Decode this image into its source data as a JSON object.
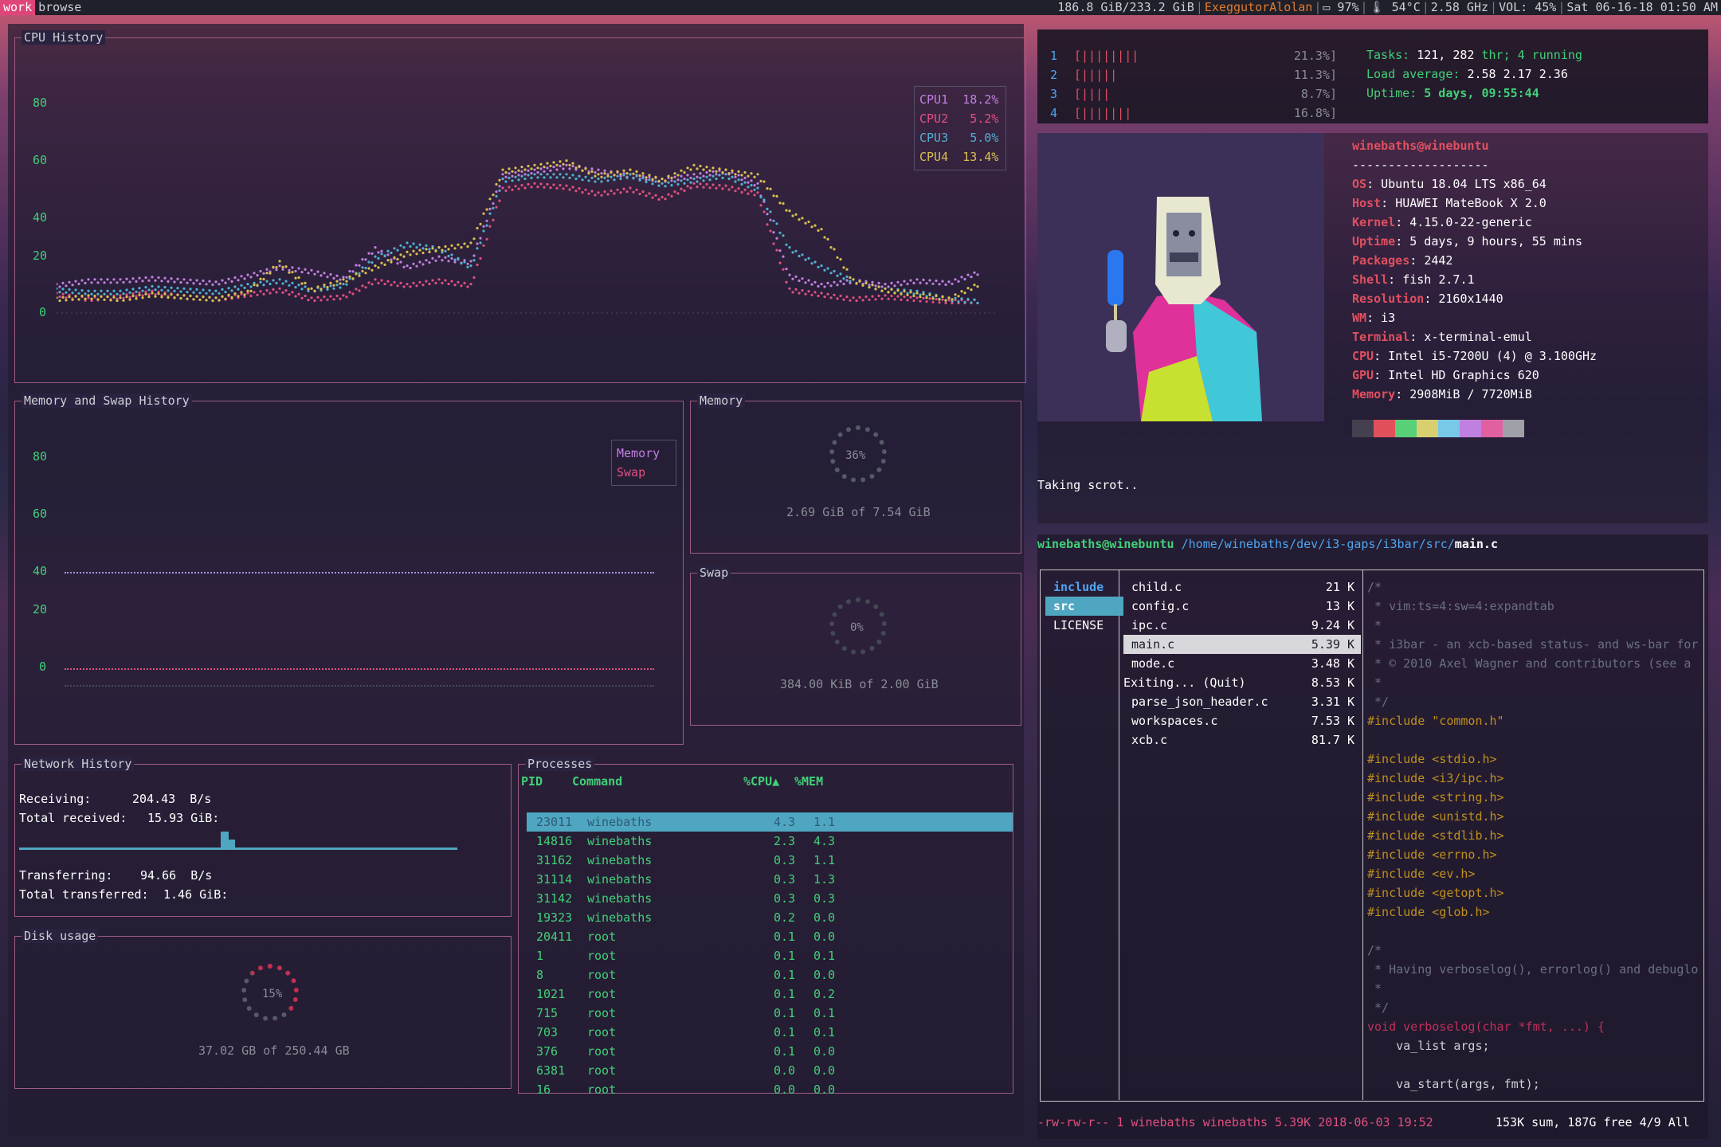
{
  "topbar": {
    "workspaces": [
      "work",
      "browse"
    ],
    "disk": "186.8 GiB/233.2 GiB",
    "wifi": "ExeggutorAlolan",
    "battery": "97%",
    "temp": "54°C",
    "freq": "2.58 GHz",
    "volume": "VOL: 45%",
    "datetime": "Sat 06-16-18 01:50 AM"
  },
  "cpu_history": {
    "title": "CPU History",
    "yticks": [
      "80",
      "60",
      "40",
      "20",
      "0"
    ],
    "legend": [
      {
        "label": "CPU1",
        "value": "18.2%",
        "color": "#c080e0"
      },
      {
        "label": "CPU2",
        "value": "5.2%",
        "color": "#e05080"
      },
      {
        "label": "CPU3",
        "value": "5.0%",
        "color": "#50b0d0"
      },
      {
        "label": "CPU4",
        "value": "13.4%",
        "color": "#d8c050"
      }
    ]
  },
  "chart_data": {
    "type": "line",
    "title": "CPU History",
    "ylim": [
      0,
      100
    ],
    "series": [
      {
        "name": "CPU1",
        "values": [
          12,
          14,
          14,
          15,
          14,
          13,
          16,
          20,
          18,
          15,
          28,
          20,
          24,
          22,
          60,
          62,
          64,
          62,
          60,
          58,
          60,
          62,
          56,
          16,
          12,
          14,
          12,
          14,
          13,
          18
        ]
      },
      {
        "name": "CPU2",
        "values": [
          8,
          6,
          7,
          9,
          7,
          6,
          8,
          10,
          6,
          7,
          14,
          12,
          14,
          12,
          54,
          56,
          55,
          52,
          54,
          50,
          56,
          55,
          52,
          10,
          8,
          6,
          7,
          6,
          5,
          5
        ]
      },
      {
        "name": "CPU3",
        "values": [
          10,
          9,
          9,
          11,
          10,
          9,
          12,
          14,
          10,
          12,
          24,
          30,
          28,
          20,
          58,
          60,
          60,
          58,
          60,
          56,
          58,
          60,
          54,
          28,
          20,
          14,
          10,
          9,
          6,
          5
        ]
      },
      {
        "name": "CPU4",
        "values": [
          6,
          7,
          6,
          8,
          7,
          6,
          9,
          22,
          10,
          14,
          20,
          26,
          28,
          30,
          62,
          64,
          66,
          60,
          62,
          58,
          64,
          62,
          60,
          44,
          36,
          14,
          10,
          8,
          6,
          13
        ]
      }
    ]
  },
  "memswap": {
    "title": "Memory and Swap History",
    "yticks": [
      "80",
      "60",
      "40",
      "20",
      "0"
    ],
    "legend": [
      {
        "label": "Memory",
        "color": "#c080e0"
      },
      {
        "label": "Swap",
        "color": "#e05080"
      }
    ]
  },
  "memory": {
    "title": "Memory",
    "percent": "36%",
    "text": "2.69 GiB of 7.54 GiB"
  },
  "swap": {
    "title": "Swap",
    "percent": "0%",
    "text": "384.00 KiB of 2.00 GiB"
  },
  "network": {
    "title": "Network History",
    "receiving_label": "Receiving:",
    "receiving_value": "204.43  B/s",
    "total_received_label": "Total received:",
    "total_received_value": "15.93 GiB:",
    "transferring_label": "Transferring:",
    "transferring_value": "94.66  B/s",
    "total_transferred_label": "Total transferred:",
    "total_transferred_value": "1.46 GiB:"
  },
  "disk": {
    "title": "Disk usage",
    "percent": "15%",
    "text": "37.02 GB of 250.44 GB"
  },
  "processes": {
    "title": "Processes",
    "headers": [
      "PID",
      "Command",
      "%CPU▲",
      "%MEM"
    ],
    "rows": [
      {
        "pid": "23011",
        "cmd": "winebaths",
        "cpu": "4.3",
        "mem": "1.1"
      },
      {
        "pid": "14816",
        "cmd": "winebaths",
        "cpu": "2.3",
        "mem": "4.3"
      },
      {
        "pid": "31162",
        "cmd": "winebaths",
        "cpu": "0.3",
        "mem": "1.1"
      },
      {
        "pid": "31114",
        "cmd": "winebaths",
        "cpu": "0.3",
        "mem": "1.3"
      },
      {
        "pid": "31142",
        "cmd": "winebaths",
        "cpu": "0.3",
        "mem": "0.3"
      },
      {
        "pid": "19323",
        "cmd": "winebaths",
        "cpu": "0.2",
        "mem": "0.0"
      },
      {
        "pid": "20411",
        "cmd": "root",
        "cpu": "0.1",
        "mem": "0.0"
      },
      {
        "pid": "1",
        "cmd": "root",
        "cpu": "0.1",
        "mem": "0.1"
      },
      {
        "pid": "8",
        "cmd": "root",
        "cpu": "0.1",
        "mem": "0.0"
      },
      {
        "pid": "1021",
        "cmd": "root",
        "cpu": "0.1",
        "mem": "0.2"
      },
      {
        "pid": "715",
        "cmd": "root",
        "cpu": "0.1",
        "mem": "0.1"
      },
      {
        "pid": "703",
        "cmd": "root",
        "cpu": "0.1",
        "mem": "0.1"
      },
      {
        "pid": "376",
        "cmd": "root",
        "cpu": "0.1",
        "mem": "0.0"
      },
      {
        "pid": "6381",
        "cmd": "root",
        "cpu": "0.0",
        "mem": "0.0"
      },
      {
        "pid": "16",
        "cmd": "root",
        "cpu": "0.0",
        "mem": "0.0"
      }
    ]
  },
  "htop": {
    "cpus": [
      {
        "num": "1",
        "bar": "[||||||||",
        "pct": "21.3%]"
      },
      {
        "num": "2",
        "bar": "[|||||",
        "pct": "11.3%]"
      },
      {
        "num": "3",
        "bar": "[||||",
        "pct": "8.7%]"
      },
      {
        "num": "4",
        "bar": "[|||||||",
        "pct": "16.8%]"
      }
    ],
    "tasks_label": "Tasks:",
    "tasks_value": "121,",
    "threads_value": "282",
    "threads_label": "thr;",
    "running_value": "4",
    "running_label": "running",
    "load_label": "Load average:",
    "load_values": "2.58 2.17 2.36",
    "uptime_label": "Uptime:",
    "uptime_value": "5 days, 09:55:44"
  },
  "neofetch": {
    "userhost": "winebaths@winebuntu",
    "separator": "-------------------",
    "info": [
      {
        "key": "OS",
        "value": "Ubuntu 18.04 LTS x86_64"
      },
      {
        "key": "Host",
        "value": "HUAWEI MateBook X 2.0"
      },
      {
        "key": "Kernel",
        "value": "4.15.0-22-generic"
      },
      {
        "key": "Uptime",
        "value": "5 days, 9 hours, 55 mins"
      },
      {
        "key": "Packages",
        "value": "2442"
      },
      {
        "key": "Shell",
        "value": "fish 2.7.1"
      },
      {
        "key": "Resolution",
        "value": "2160x1440"
      },
      {
        "key": "WM",
        "value": "i3"
      },
      {
        "key": "Terminal",
        "value": "x-terminal-emul"
      },
      {
        "key": "CPU",
        "value": "Intel i5-7200U (4) @ 3.100GHz"
      },
      {
        "key": "GPU",
        "value": "Intel HD Graphics 620"
      },
      {
        "key": "Memory",
        "value": "2908MiB / 7720MiB"
      }
    ],
    "palette": [
      "#44404f",
      "#e0505a",
      "#58d078",
      "#d8d070",
      "#78c8e8",
      "#c080e0",
      "#e060a0",
      "#a0a0a8"
    ],
    "status_line": "Taking scrot.."
  },
  "ranger": {
    "user": "winebaths@winebuntu",
    "path": "/home/winebaths/dev/i3-gaps/i3bar/src/",
    "file": "main.c",
    "left_col": [
      "include",
      "src",
      "LICENSE"
    ],
    "files": [
      {
        "name": "child.c",
        "size": "21 K"
      },
      {
        "name": "config.c",
        "size": "13 K"
      },
      {
        "name": "ipc.c",
        "size": "9.24 K"
      },
      {
        "name": "main.c",
        "size": "5.39 K"
      },
      {
        "name": "mode.c",
        "size": "3.48 K"
      },
      {
        "name": "Exiting... (Quit)",
        "size": "8.53 K"
      },
      {
        "name": "parse_json_header.c",
        "size": "3.31 K"
      },
      {
        "name": "workspaces.c",
        "size": "7.53 K"
      },
      {
        "name": "xcb.c",
        "size": "81.7 K"
      }
    ],
    "status_left": "-rw-rw-r-- 1 winebaths winebaths 5.39K 2018-06-03 19:52",
    "status_right": "153K sum, 187G free  4/9  All"
  },
  "code_lines": [
    "/*",
    " * vim:ts=4:sw=4:expandtab",
    " *",
    " * i3bar - an xcb-based status- and ws-bar for",
    " * © 2010 Axel Wagner and contributors (see a",
    " *",
    " */",
    "#include \"common.h\"",
    "",
    "#include <stdio.h>",
    "#include <i3/ipc.h>",
    "#include <string.h>",
    "#include <unistd.h>",
    "#include <stdlib.h>",
    "#include <errno.h>",
    "#include <ev.h>",
    "#include <getopt.h>",
    "#include <glob.h>",
    "",
    "/*",
    " * Having verboselog(), errorlog() and debuglo",
    " *",
    " */",
    "void verboselog(char *fmt, ...) {",
    "    va_list args;",
    "",
    "    va_start(args, fmt);"
  ]
}
